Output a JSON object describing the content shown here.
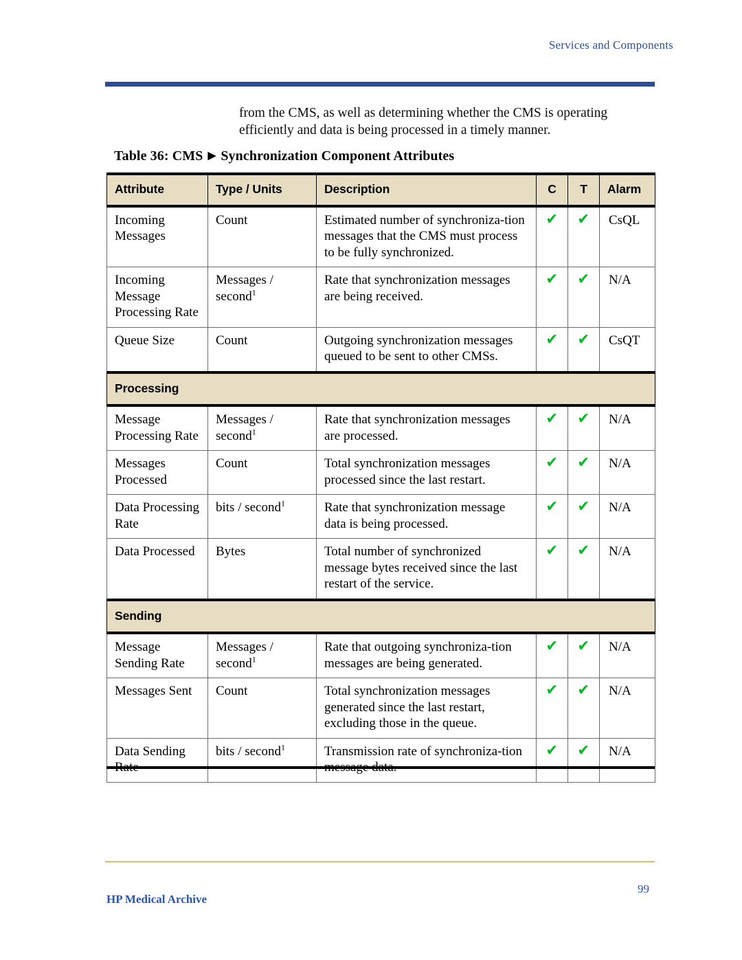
{
  "running_head": "Services and Components",
  "body_paragraph": "from the CMS, as well as determining whether the CMS is operating efficiently and data is being processed in a timely manner.",
  "table": {
    "caption_prefix": "Table 36: CMS",
    "caption_arrow": "▶",
    "caption_suffix": "Synchronization Component Attributes",
    "columns": [
      {
        "label": "Attribute"
      },
      {
        "label": "Type / Units"
      },
      {
        "label": "Description"
      },
      {
        "label": "C"
      },
      {
        "label": "T"
      },
      {
        "label": "Alarm"
      }
    ],
    "check_mark": "✔",
    "blocks": [
      {
        "section_label": null,
        "rows": [
          {
            "attribute": "Incoming Messages",
            "type_units": "Count",
            "type_units_footnote": "",
            "description": "Estimated number of synchroniza-tion messages that the CMS must process to be fully synchronized.",
            "c": true,
            "t": true,
            "alarm": "CsQL"
          },
          {
            "attribute": "Incoming Message Processing Rate",
            "type_units": "Messages / second",
            "type_units_footnote": "1",
            "description": "Rate that synchronization messages are being received.",
            "c": true,
            "t": true,
            "alarm": "N/A"
          },
          {
            "attribute": "Queue Size",
            "type_units": "Count",
            "type_units_footnote": "",
            "description": "Outgoing synchronization messages queued to be sent to other CMSs.",
            "c": true,
            "t": true,
            "alarm": "CsQT"
          }
        ]
      },
      {
        "section_label": "Processing",
        "rows": [
          {
            "attribute": "Message Processing Rate",
            "type_units": "Messages / second",
            "type_units_footnote": "1",
            "description": "Rate that synchronization messages are processed.",
            "c": true,
            "t": true,
            "alarm": "N/A"
          },
          {
            "attribute": "Messages Processed",
            "type_units": "Count",
            "type_units_footnote": "",
            "description": "Total synchronization messages processed since the last restart.",
            "c": true,
            "t": true,
            "alarm": "N/A"
          },
          {
            "attribute": "Data Processing Rate",
            "type_units": "bits / second",
            "type_units_footnote": "1",
            "description": "Rate that synchronization message data is being processed.",
            "c": true,
            "t": true,
            "alarm": "N/A"
          },
          {
            "attribute": "Data Processed",
            "type_units": "Bytes",
            "type_units_footnote": "",
            "description": "Total number of synchronized message bytes received since the last restart of the service.",
            "c": true,
            "t": true,
            "alarm": "N/A"
          }
        ]
      },
      {
        "section_label": "Sending",
        "rows": [
          {
            "attribute": "Message Sending Rate",
            "type_units": "Messages / second",
            "type_units_footnote": "1",
            "description": "Rate that outgoing synchroniza-tion messages are being generated.",
            "c": true,
            "t": true,
            "alarm": "N/A"
          },
          {
            "attribute": "Messages Sent",
            "type_units": "Count",
            "type_units_footnote": "",
            "description": "Total synchronization messages generated since the last restart, excluding those in the queue.",
            "c": true,
            "t": true,
            "alarm": "N/A"
          },
          {
            "attribute": "Data Sending Rate",
            "type_units": "bits / second",
            "type_units_footnote": "1",
            "description": "Transmission rate of synchroniza-tion message data.",
            "c": true,
            "t": true,
            "alarm": "N/A"
          }
        ]
      }
    ]
  },
  "footer": {
    "left": "HP Medical Archive",
    "page_number": "99"
  },
  "colors": {
    "header_rule": "#2a4d9b",
    "running_head": "#2a4d9b",
    "table_header_bg": "#e6ddc3",
    "check_green": "#00bb22",
    "footer_rule": "#d9b96b",
    "footer_text": "#2a55b0"
  }
}
